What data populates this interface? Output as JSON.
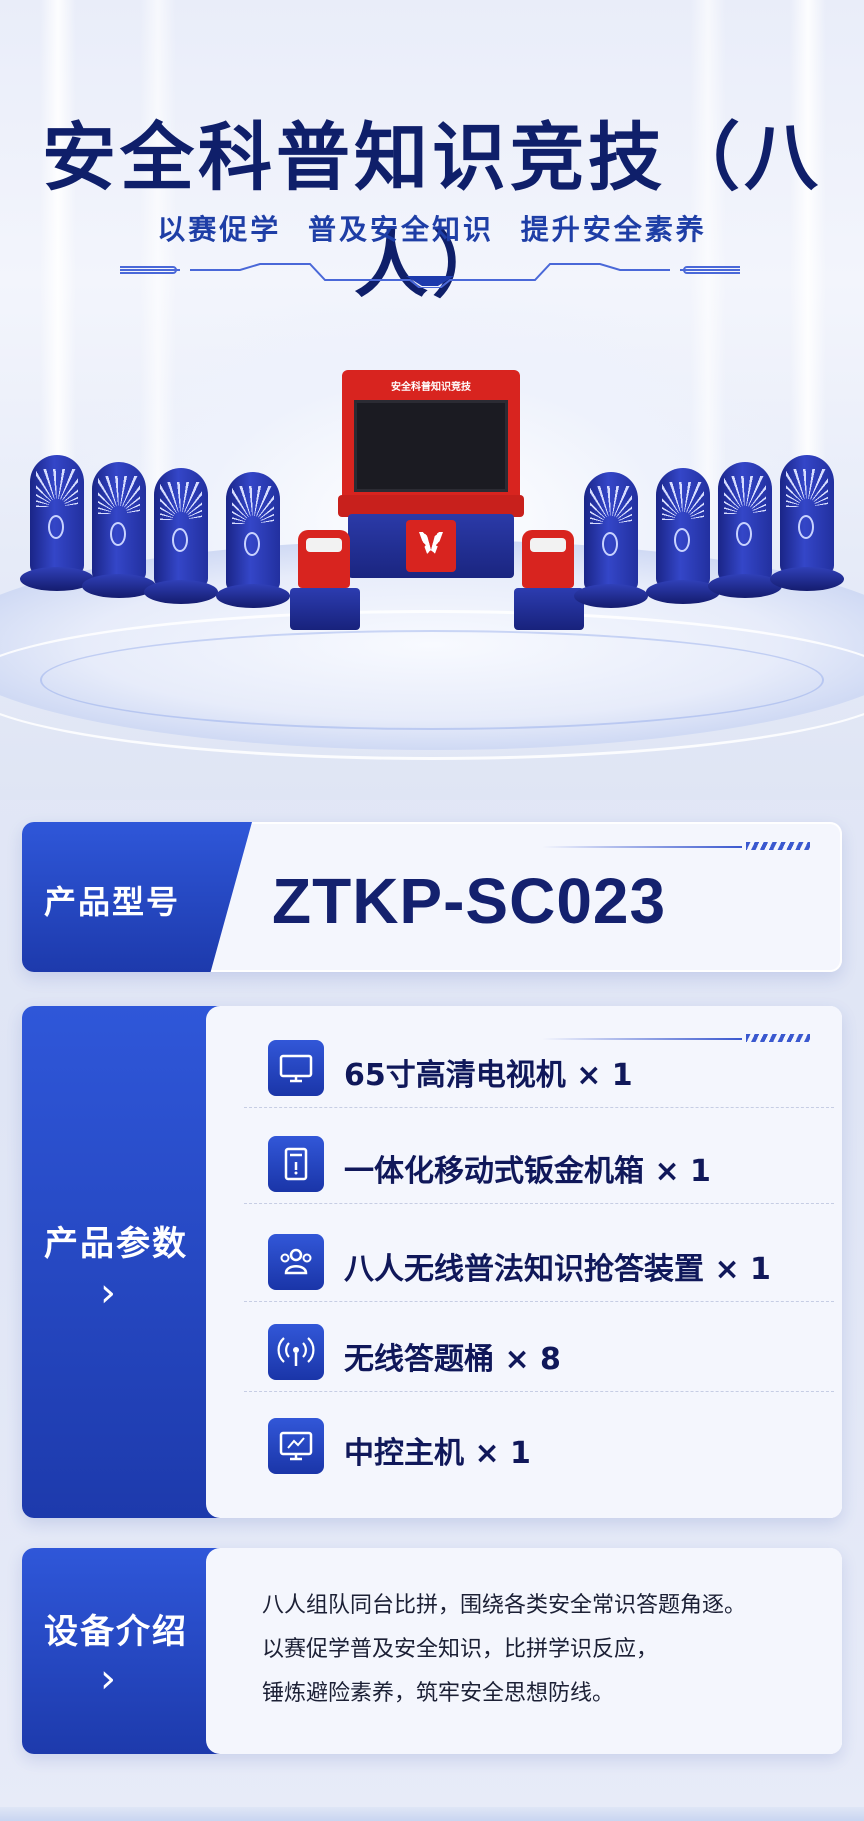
{
  "hero": {
    "title": "安全科普知识竞技（八人）",
    "subtitle": "以赛促学 普及安全知识 提升安全素养",
    "kiosk_header": "安全科普知识竞技"
  },
  "model": {
    "label": "产品型号",
    "value": "ZTKP-SC023"
  },
  "params": {
    "label": "产品参数",
    "items": [
      {
        "icon": "monitor-icon",
        "text": "65寸高清电视机 × 1"
      },
      {
        "icon": "cabinet-icon",
        "text": "一体化移动式钣金机箱 × 1"
      },
      {
        "icon": "users-icon",
        "text": "八人无线普法知识抢答装置 × 1"
      },
      {
        "icon": "wireless-icon",
        "text": "无线答题桶 × 8"
      },
      {
        "icon": "control-host-icon",
        "text": "中控主机 × 1"
      }
    ]
  },
  "intro": {
    "label": "设备介绍",
    "lines": [
      "八人组队同台比拼，围绕各类安全常识答题角逐。",
      "以赛促学普及安全知识，比拼学识反应，",
      "锤炼避险素养，筑牢安全思想防线。"
    ]
  },
  "colors": {
    "title": "#0f1f6a",
    "accent_blue": "#2f57d9",
    "kiosk_red": "#d8241f",
    "seat_blue": "#2233a0"
  }
}
